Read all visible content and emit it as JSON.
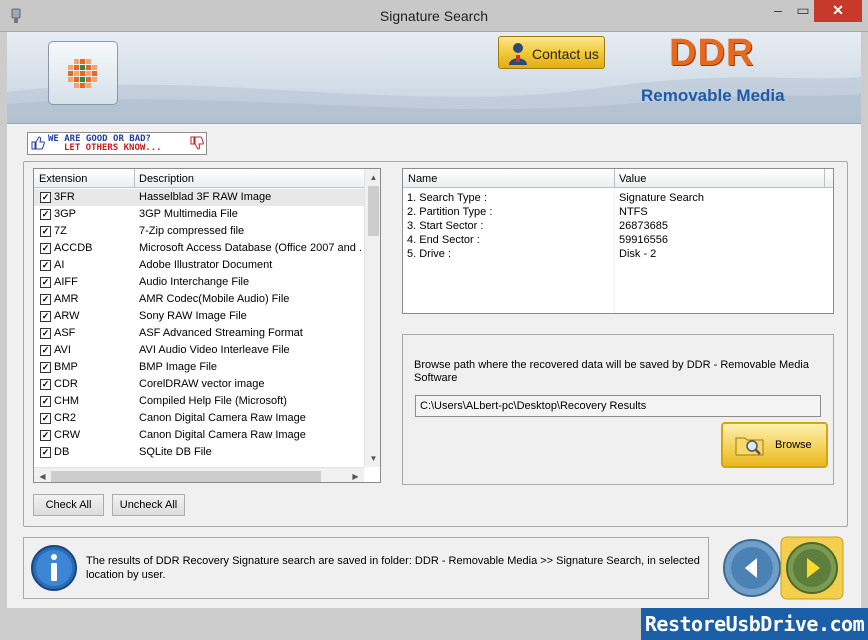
{
  "window": {
    "title": "Signature Search",
    "minimize": "–",
    "maximize": "▭",
    "close": "✕"
  },
  "header": {
    "contact_label": "Contact us",
    "brand": "DDR",
    "brand_sub": "Removable Media"
  },
  "rating_banner": {
    "line1": "WE ARE GOOD OR BAD?",
    "line2": "LET OTHERS KNOW..."
  },
  "extension_list": {
    "columns": [
      "Extension",
      "Description"
    ],
    "rows": [
      {
        "ext": "3FR",
        "desc": "Hasselblad 3F RAW Image",
        "checked": true
      },
      {
        "ext": "3GP",
        "desc": "3GP Multimedia File",
        "checked": true
      },
      {
        "ext": "7Z",
        "desc": "7-Zip compressed file",
        "checked": true
      },
      {
        "ext": "ACCDB",
        "desc": "Microsoft Access Database (Office 2007 and ...",
        "checked": true
      },
      {
        "ext": "AI",
        "desc": "Adobe Illustrator Document",
        "checked": true
      },
      {
        "ext": "AIFF",
        "desc": "Audio Interchange File",
        "checked": true
      },
      {
        "ext": "AMR",
        "desc": "AMR Codec(Mobile Audio) File",
        "checked": true
      },
      {
        "ext": "ARW",
        "desc": "Sony RAW Image File",
        "checked": true
      },
      {
        "ext": "ASF",
        "desc": "ASF Advanced Streaming Format",
        "checked": true
      },
      {
        "ext": "AVI",
        "desc": "AVI Audio Video Interleave File",
        "checked": true
      },
      {
        "ext": "BMP",
        "desc": "BMP Image File",
        "checked": true
      },
      {
        "ext": "CDR",
        "desc": "CorelDRAW vector image",
        "checked": true
      },
      {
        "ext": "CHM",
        "desc": "Compiled Help File (Microsoft)",
        "checked": true
      },
      {
        "ext": "CR2",
        "desc": "Canon Digital Camera Raw Image",
        "checked": true
      },
      {
        "ext": "CRW",
        "desc": "Canon Digital Camera Raw Image",
        "checked": true
      },
      {
        "ext": "DB",
        "desc": "SQLite DB File",
        "checked": true
      }
    ]
  },
  "buttons": {
    "check_all": "Check All",
    "uncheck_all": "Uncheck All",
    "browse": "Browse"
  },
  "info_table": {
    "columns": [
      "Name",
      "Value"
    ],
    "rows": [
      {
        "name": "1. Search Type :",
        "value": "Signature Search"
      },
      {
        "name": "2. Partition Type :",
        "value": "NTFS"
      },
      {
        "name": "3. Start Sector :",
        "value": "26873685"
      },
      {
        "name": "4. End Sector :",
        "value": "59916556"
      },
      {
        "name": "5. Drive :",
        "value": "Disk - 2"
      }
    ]
  },
  "browse": {
    "message": "Browse path where the recovered data will be saved by DDR - Removable Media Software",
    "path": "C:\\Users\\ALbert-pc\\Desktop\\Recovery Results"
  },
  "status": {
    "message": "The results of DDR Recovery Signature search are saved in folder: DDR - Removable Media  >> Signature Search, in selected location by user."
  },
  "watermark": "RestoreUsbDrive.com",
  "colors": {
    "brand": "#e8681e",
    "brand_sub": "#1f5aa8",
    "accent_gold": "#f1c733",
    "close_red": "#c7392b"
  }
}
